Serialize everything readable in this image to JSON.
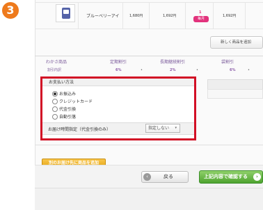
{
  "step": {
    "number": "3"
  },
  "product": {
    "name": "ブルーベリーアイ",
    "unit_price": "1,680円",
    "price": "1,692円",
    "qty": "1",
    "qty_badge": "毎月",
    "subtotal": "1,692円",
    "thumbnail_icon": "product-box-icon"
  },
  "change_button": {
    "label": "新しく商品を追加"
  },
  "discounts": {
    "headers": [
      "わかさ商品",
      "定期割引",
      "長期継続割引",
      "袋割引"
    ],
    "row_label": "割引内訳",
    "values": [
      "6%",
      "2%",
      "6%"
    ]
  },
  "payment": {
    "title": "お支払い方法",
    "options": [
      {
        "label": "お振込み",
        "selected": true
      },
      {
        "label": "クレジットカード",
        "selected": false
      },
      {
        "label": "代金引換",
        "selected": false
      },
      {
        "label": "自動引落",
        "selected": false
      }
    ],
    "delivery_time_label": "お届け時間指定（代金引換のみ）",
    "delivery_time_value": "指定しない"
  },
  "ship_other_button": {
    "label": "別のお届け先に商品を追加"
  },
  "back_button": {
    "label": "戻る"
  },
  "confirm_button": {
    "label": "上記内容で確認する"
  },
  "colors": {
    "highlight_border": "#d20f25",
    "step_badge": "#ee7a1c",
    "confirm_green": "#4ea32f",
    "ship_orange": "#e6a91c"
  }
}
